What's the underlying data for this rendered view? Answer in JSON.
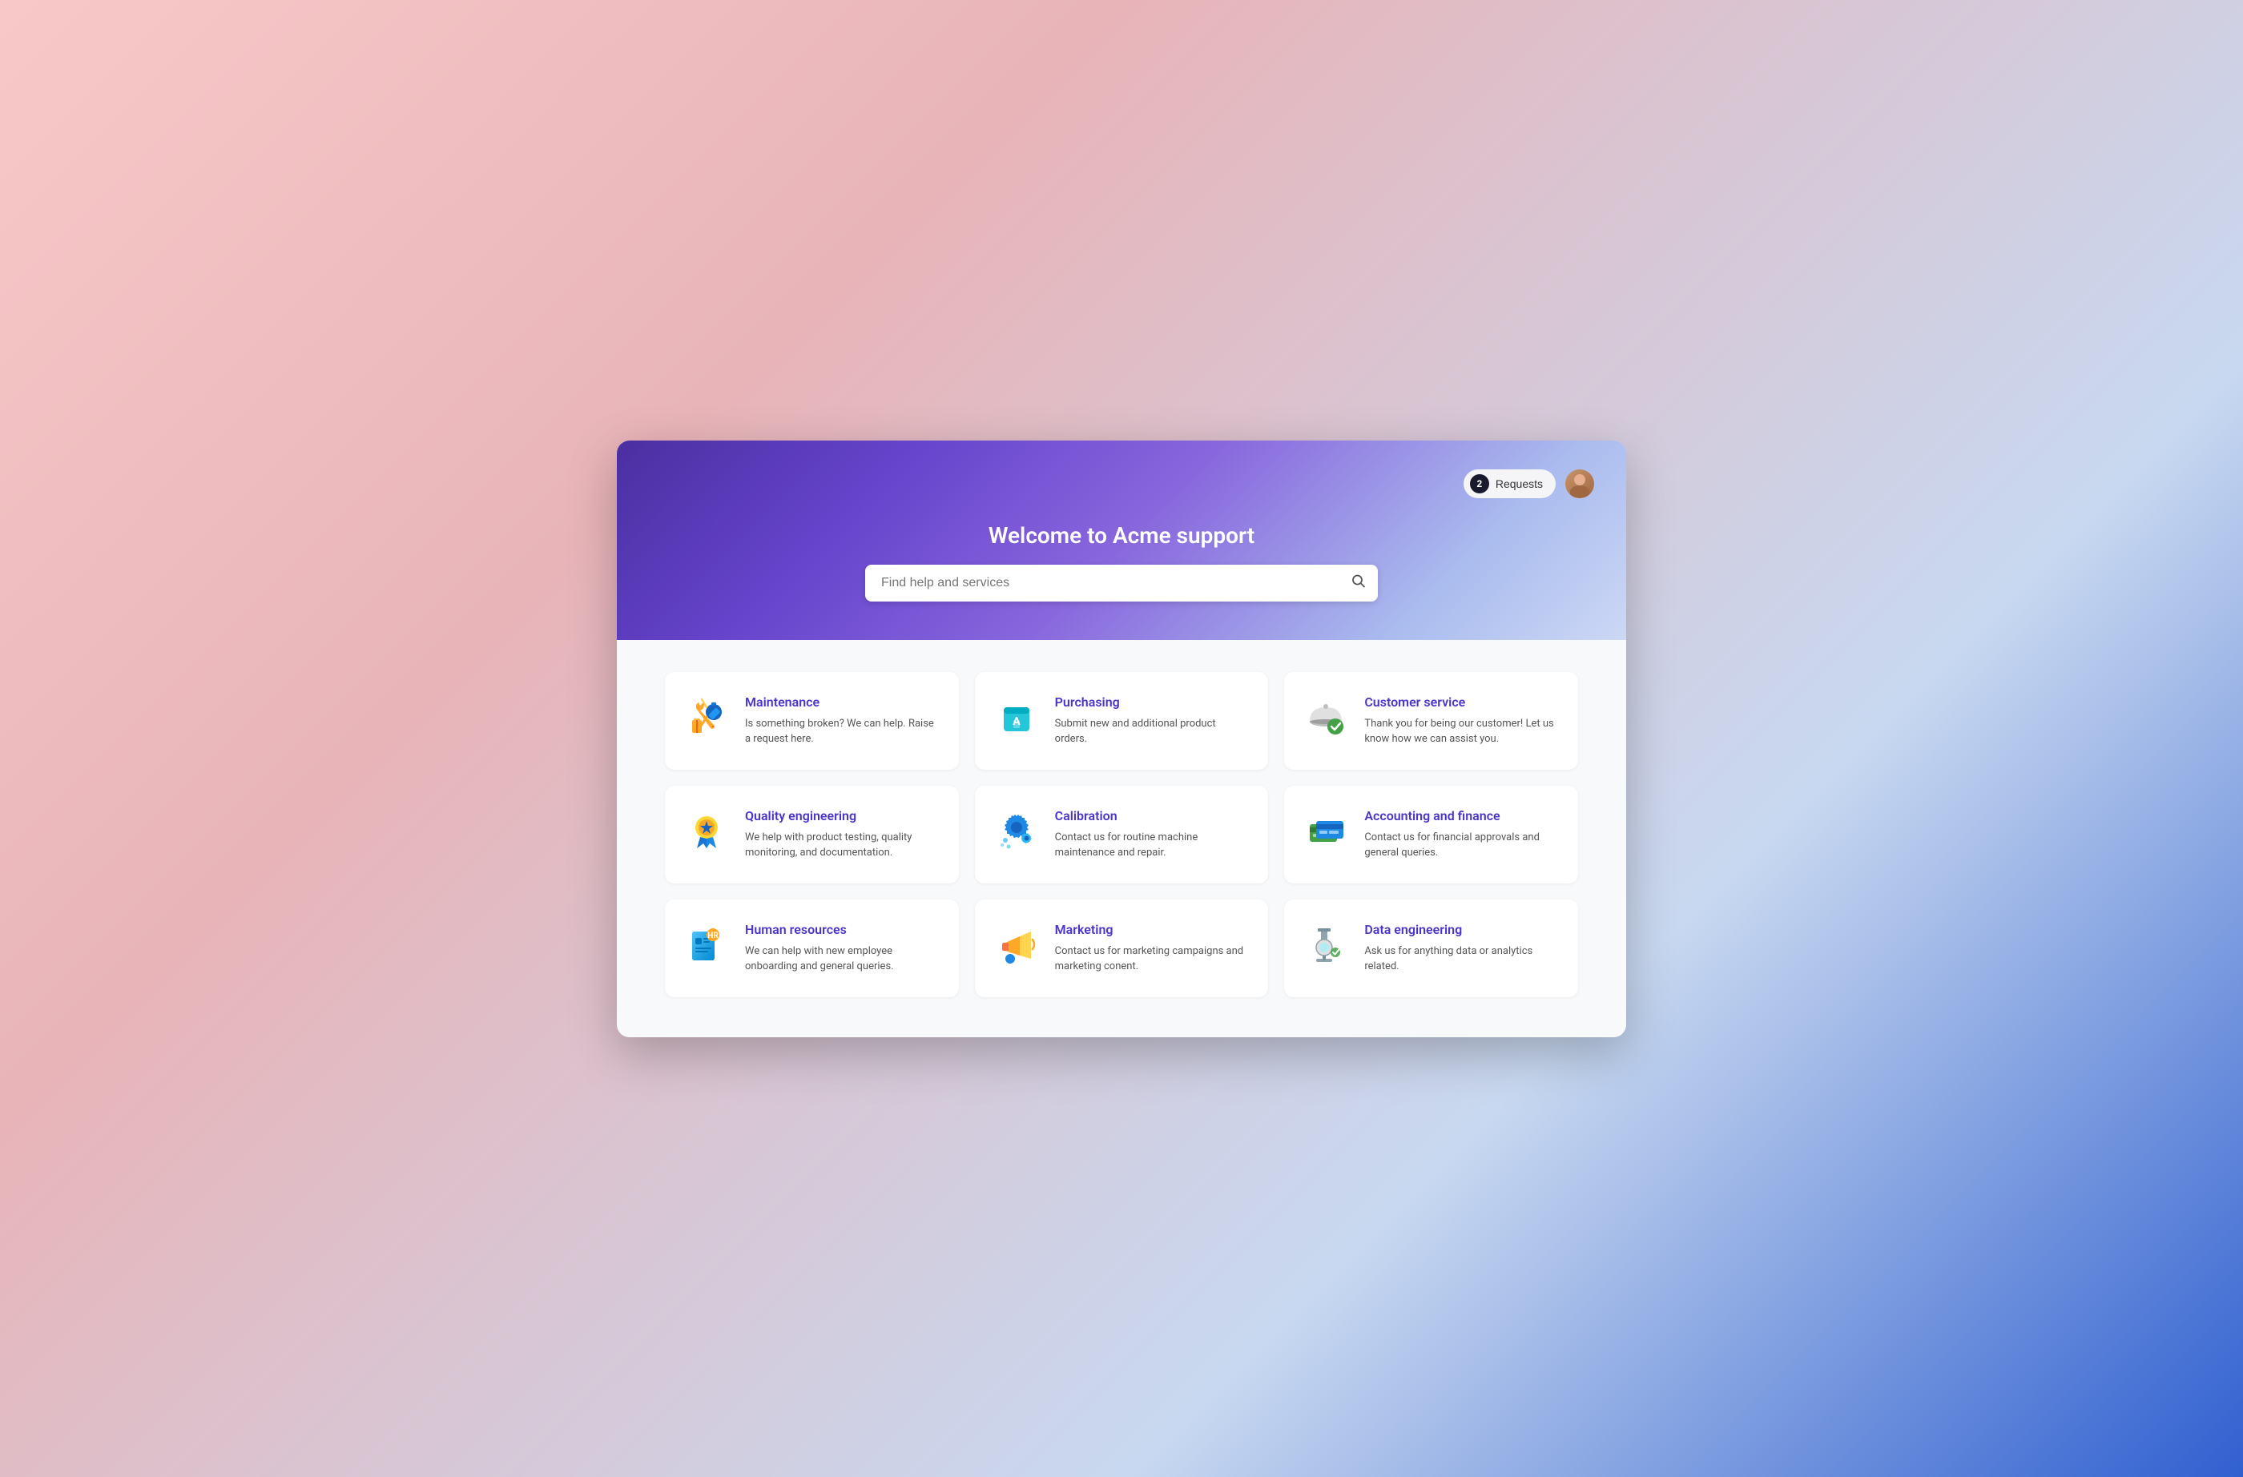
{
  "header": {
    "title": "Welcome to Acme support",
    "requests_label": "Requests",
    "requests_count": "2"
  },
  "search": {
    "placeholder": "Find help and services"
  },
  "cards": [
    {
      "id": "maintenance",
      "title": "Maintenance",
      "description": "Is something broken? We can help. Raise a request here."
    },
    {
      "id": "purchasing",
      "title": "Purchasing",
      "description": "Submit new and additional product orders."
    },
    {
      "id": "customer-service",
      "title": "Customer service",
      "description": "Thank you for being our customer! Let us know how we can assist you."
    },
    {
      "id": "quality-engineering",
      "title": "Quality engineering",
      "description": "We help with product testing, quality monitoring, and documentation."
    },
    {
      "id": "calibration",
      "title": "Calibration",
      "description": "Contact us for routine machine maintenance and repair."
    },
    {
      "id": "accounting-finance",
      "title": "Accounting and finance",
      "description": "Contact us for financial approvals and general queries."
    },
    {
      "id": "human-resources",
      "title": "Human resources",
      "description": "We can help with new employee onboarding and general queries."
    },
    {
      "id": "marketing",
      "title": "Marketing",
      "description": "Contact us for marketing campaigns and marketing conent."
    },
    {
      "id": "data-engineering",
      "title": "Data engineering",
      "description": "Ask us for anything data or analytics related."
    }
  ]
}
